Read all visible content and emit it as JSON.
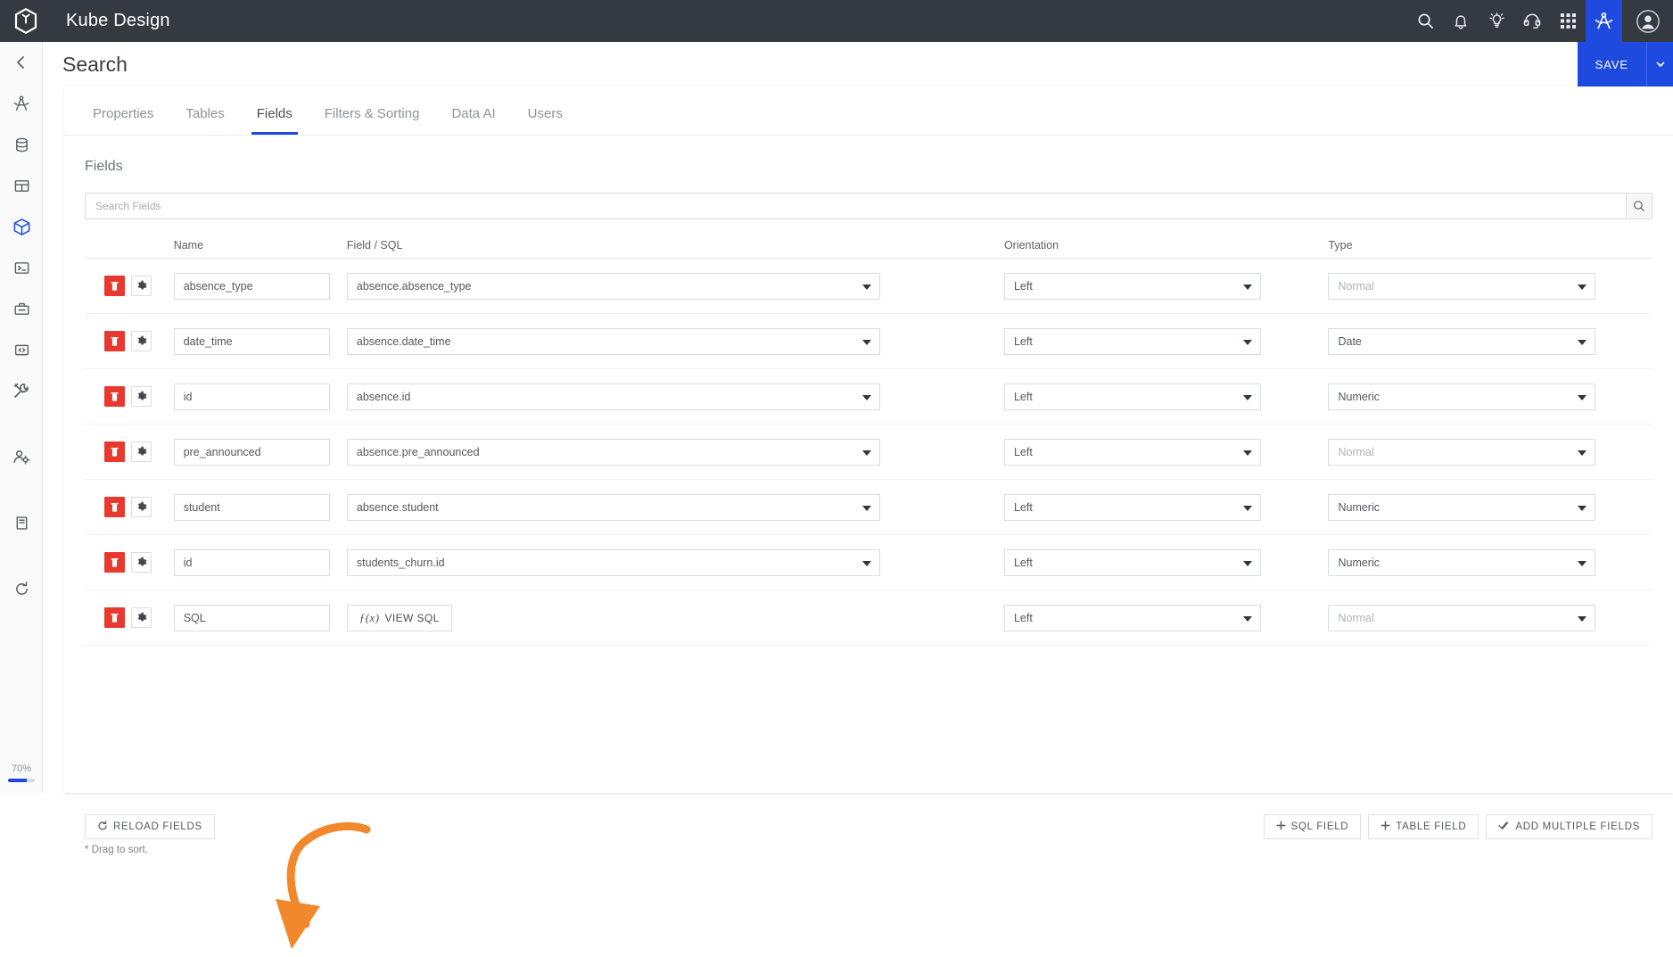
{
  "topbar": {
    "brand": "Kube Design",
    "logo_icon": "hexagon-kube-logo-icon",
    "icons": [
      {
        "name": "search-icon",
        "label": "Search"
      },
      {
        "name": "bell-icon",
        "label": "Notifications"
      },
      {
        "name": "lightbulb-icon",
        "label": "Ideas"
      },
      {
        "name": "headset-icon",
        "label": "Support"
      },
      {
        "name": "grid-apps-icon",
        "label": "Apps"
      },
      {
        "name": "compass-icon",
        "label": "Design",
        "active": true
      }
    ],
    "avatar_icon": "user-avatar-icon"
  },
  "rail": {
    "items": [
      {
        "name": "back-chevron-icon",
        "label": "Back"
      },
      {
        "name": "compass-icon",
        "label": "Design"
      },
      {
        "name": "database-icon",
        "label": "Data Sources"
      },
      {
        "name": "table-icon",
        "label": "Tables"
      },
      {
        "name": "cube-icon",
        "label": "Models",
        "active": true
      },
      {
        "name": "terminal-icon",
        "label": "Console"
      },
      {
        "name": "toolbox-icon",
        "label": "Toolbox"
      },
      {
        "name": "code-brackets-icon",
        "label": "Code"
      },
      {
        "name": "tools-icon",
        "label": "Utilities"
      },
      {
        "name": "user-settings-icon",
        "label": "User Settings"
      },
      {
        "name": "book-icon",
        "label": "Docs"
      },
      {
        "name": "refresh-icon",
        "label": "Refresh"
      }
    ],
    "progress_label": "70%",
    "progress_value": 70
  },
  "header": {
    "title": "Search",
    "save_label": "SAVE",
    "save_caret_icon": "chevron-down-icon"
  },
  "tabs": [
    {
      "label": "Properties",
      "active": false
    },
    {
      "label": "Tables",
      "active": false
    },
    {
      "label": "Fields",
      "active": true
    },
    {
      "label": "Filters & Sorting",
      "active": false
    },
    {
      "label": "Data AI",
      "active": false
    },
    {
      "label": "Users",
      "active": false
    }
  ],
  "section": {
    "title": "Fields"
  },
  "search": {
    "placeholder": "Search Fields",
    "value": "",
    "button_icon": "search-icon"
  },
  "table": {
    "columns": [
      "",
      "Name",
      "Field / SQL",
      "Orientation",
      "Type"
    ],
    "rows": [
      {
        "name": "absence_type",
        "sql": "absence.absence_type",
        "sql_is_button": false,
        "orientation": "Left",
        "type": "Normal",
        "type_placeholder": true
      },
      {
        "name": "date_time",
        "sql": "absence.date_time",
        "sql_is_button": false,
        "orientation": "Left",
        "type": "Date",
        "type_placeholder": false
      },
      {
        "name": "id",
        "sql": "absence.id",
        "sql_is_button": false,
        "orientation": "Left",
        "type": "Numeric",
        "type_placeholder": false
      },
      {
        "name": "pre_announced",
        "sql": "absence.pre_announced",
        "sql_is_button": false,
        "orientation": "Left",
        "type": "Normal",
        "type_placeholder": true
      },
      {
        "name": "student",
        "sql": "absence.student",
        "sql_is_button": false,
        "orientation": "Left",
        "type": "Numeric",
        "type_placeholder": false
      },
      {
        "name": "id",
        "sql": "students_churn.id",
        "sql_is_button": false,
        "orientation": "Left",
        "type": "Numeric",
        "type_placeholder": false
      },
      {
        "name": "SQL",
        "sql": "VIEW SQL",
        "sql_is_button": true,
        "orientation": "Left",
        "type": "Normal",
        "type_placeholder": true
      }
    ],
    "row_delete_icon": "trash-icon",
    "row_settings_icon": "gear-icon",
    "dropdown_icon": "caret-down-icon"
  },
  "footer": {
    "reload_label": "RELOAD FIELDS",
    "reload_icon": "refresh-icon",
    "hint": "* Drag to sort.",
    "sql_field_label": "SQL FIELD",
    "table_field_label": "TABLE FIELD",
    "add_multiple_label": "ADD MULTIPLE FIELDS"
  },
  "annotation": {
    "color": "#F2882B",
    "shape": "curved-arrow-pointing-to-gear-of-sql-row"
  },
  "colors": {
    "topbar_bg": "#343a40",
    "accent_blue": "#1f4ae0",
    "delete_red": "#e8392e",
    "annotation_orange": "#F2882B"
  }
}
